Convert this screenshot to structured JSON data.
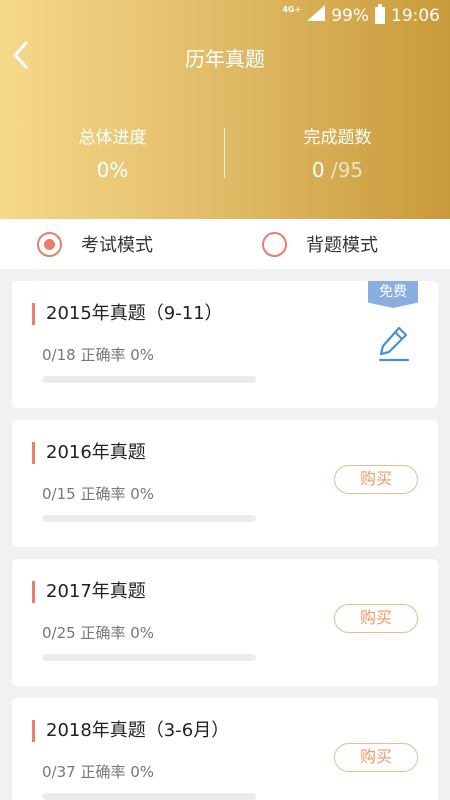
{
  "status_bar": {
    "network": "4G+",
    "battery": "99%",
    "time": "19:06"
  },
  "header": {
    "title": "历年真题",
    "progress_label": "总体进度",
    "progress_value": "0%",
    "completed_label": "完成题数",
    "completed_done": "0",
    "completed_total": "/95"
  },
  "modes": [
    {
      "label": "考试模式",
      "selected": true
    },
    {
      "label": "背题模式",
      "selected": false
    }
  ],
  "papers": [
    {
      "title": "2015年真题（9-11）",
      "stats": "0/18 正确率 0%",
      "progress": 0,
      "badge": "免费",
      "action": "edit-icon"
    },
    {
      "title": "2016年真题",
      "stats": "0/15 正确率 0%",
      "progress": 0,
      "action_label": "购买"
    },
    {
      "title": "2017年真题",
      "stats": "0/25 正确率 0%",
      "progress": 0,
      "action_label": "购买"
    },
    {
      "title": "2018年真题（3-6月）",
      "stats": "0/37 正确率 0%",
      "progress": 0,
      "action_label": "购买"
    }
  ],
  "colors": {
    "accent": "#e87d68",
    "gold_start": "#f6d98a",
    "gold_end": "#c99a3a",
    "badge": "#8aaee0",
    "buy": "#ee9a62"
  }
}
